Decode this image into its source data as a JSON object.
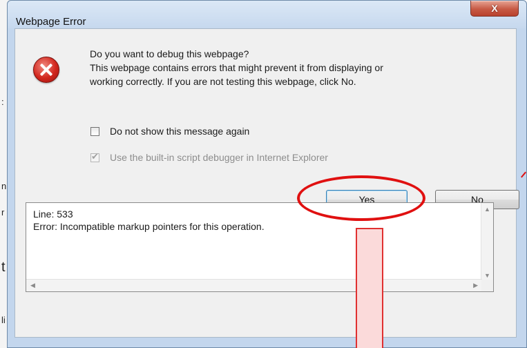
{
  "background_fragments": [
    ":",
    "n",
    "r",
    "t",
    "li"
  ],
  "window": {
    "title": "Webpage Error",
    "close_glyph": "X"
  },
  "dialog": {
    "icon": "error-icon",
    "question": "Do you want to debug this webpage?",
    "description_line1": "This webpage contains errors that might prevent it from displaying or",
    "description_line2": "working correctly. If you are not testing this webpage, click No.",
    "checkbox_dont_show": {
      "label": "Do not show this message again",
      "checked": false
    },
    "checkbox_debugger": {
      "label": "Use the built-in script debugger in Internet Explorer",
      "checked": true,
      "enabled": false
    },
    "yes_label": "Yes",
    "no_label": "No"
  },
  "details": {
    "line": "Line: 533",
    "error": "Error: Incompatible markup pointers for this operation."
  },
  "annotations": {
    "highlight_color": "#e01010",
    "bar_fill": "#fbdada"
  }
}
